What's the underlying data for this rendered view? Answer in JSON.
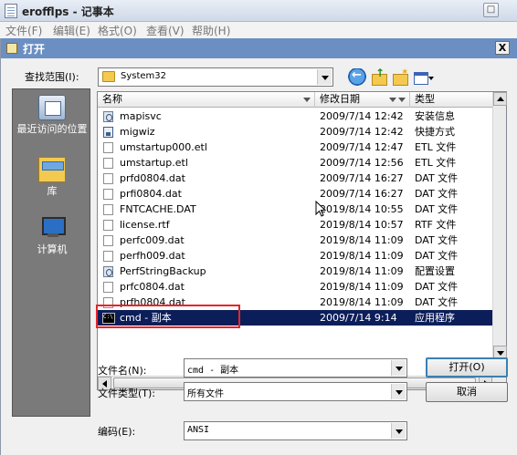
{
  "notepad": {
    "title": "erofflps - 记事本",
    "menu": [
      "文件(F)",
      "编辑(E)",
      "格式(O)",
      "查看(V)",
      "帮助(H)"
    ],
    "min_label": "_",
    "max_label": "□"
  },
  "dialog": {
    "title": "打开",
    "close_label": "X",
    "lookin_label": "查找范围(I):",
    "lookin_value": "System32",
    "places": [
      {
        "label": "最近访问的位置",
        "icon": "recent-places-icon"
      },
      {
        "label": "库",
        "icon": "libraries-icon"
      },
      {
        "label": "计算机",
        "icon": "computer-icon"
      }
    ],
    "columns": {
      "name": "名称",
      "date": "修改日期",
      "type": "类型"
    },
    "files": [
      {
        "name": "mapisvc",
        "date": "2009/7/14 12:42",
        "type": "安装信息",
        "icon": "settings-file-icon"
      },
      {
        "name": "migwiz",
        "date": "2009/7/14 12:42",
        "type": "快捷方式",
        "icon": "shortcut-icon"
      },
      {
        "name": "umstartup000.etl",
        "date": "2009/7/14 12:47",
        "type": "ETL 文件",
        "icon": "file-icon"
      },
      {
        "name": "umstartup.etl",
        "date": "2009/7/14 12:56",
        "type": "ETL 文件",
        "icon": "file-icon"
      },
      {
        "name": "prfd0804.dat",
        "date": "2009/7/14 16:27",
        "type": "DAT 文件",
        "icon": "file-icon"
      },
      {
        "name": "prfi0804.dat",
        "date": "2009/7/14 16:27",
        "type": "DAT 文件",
        "icon": "file-icon"
      },
      {
        "name": "FNTCACHE.DAT",
        "date": "2019/8/14 10:55",
        "type": "DAT 文件",
        "icon": "file-icon"
      },
      {
        "name": "license.rtf",
        "date": "2019/8/14 10:57",
        "type": "RTF 文件",
        "icon": "file-icon"
      },
      {
        "name": "perfc009.dat",
        "date": "2019/8/14 11:09",
        "type": "DAT 文件",
        "icon": "file-icon"
      },
      {
        "name": "perfh009.dat",
        "date": "2019/8/14 11:09",
        "type": "DAT 文件",
        "icon": "file-icon"
      },
      {
        "name": "PerfStringBackup",
        "date": "2019/8/14 11:09",
        "type": "配置设置",
        "icon": "settings-file-icon"
      },
      {
        "name": "prfc0804.dat",
        "date": "2019/8/14 11:09",
        "type": "DAT 文件",
        "icon": "file-icon"
      },
      {
        "name": "prfh0804.dat",
        "date": "2019/8/14 11:09",
        "type": "DAT 文件",
        "icon": "file-icon"
      },
      {
        "name": "cmd - 副本",
        "date": "2009/7/14 9:14",
        "type": "应用程序",
        "icon": "cmd-icon",
        "selected": true
      }
    ],
    "filename_label": "文件名(N):",
    "filename_value": "cmd - 副本",
    "filetype_label": "文件类型(T):",
    "filetype_value": "所有文件",
    "encoding_label": "编码(E):",
    "encoding_value": "ANSI",
    "open_button": "打开(O)",
    "cancel_button": "取消"
  },
  "colors": {
    "selection": "#0c1e5a",
    "highlight_box": "#e3262a",
    "dialog_titlebar": "#6b8fc2",
    "places_bar": "#7a7a7a"
  }
}
